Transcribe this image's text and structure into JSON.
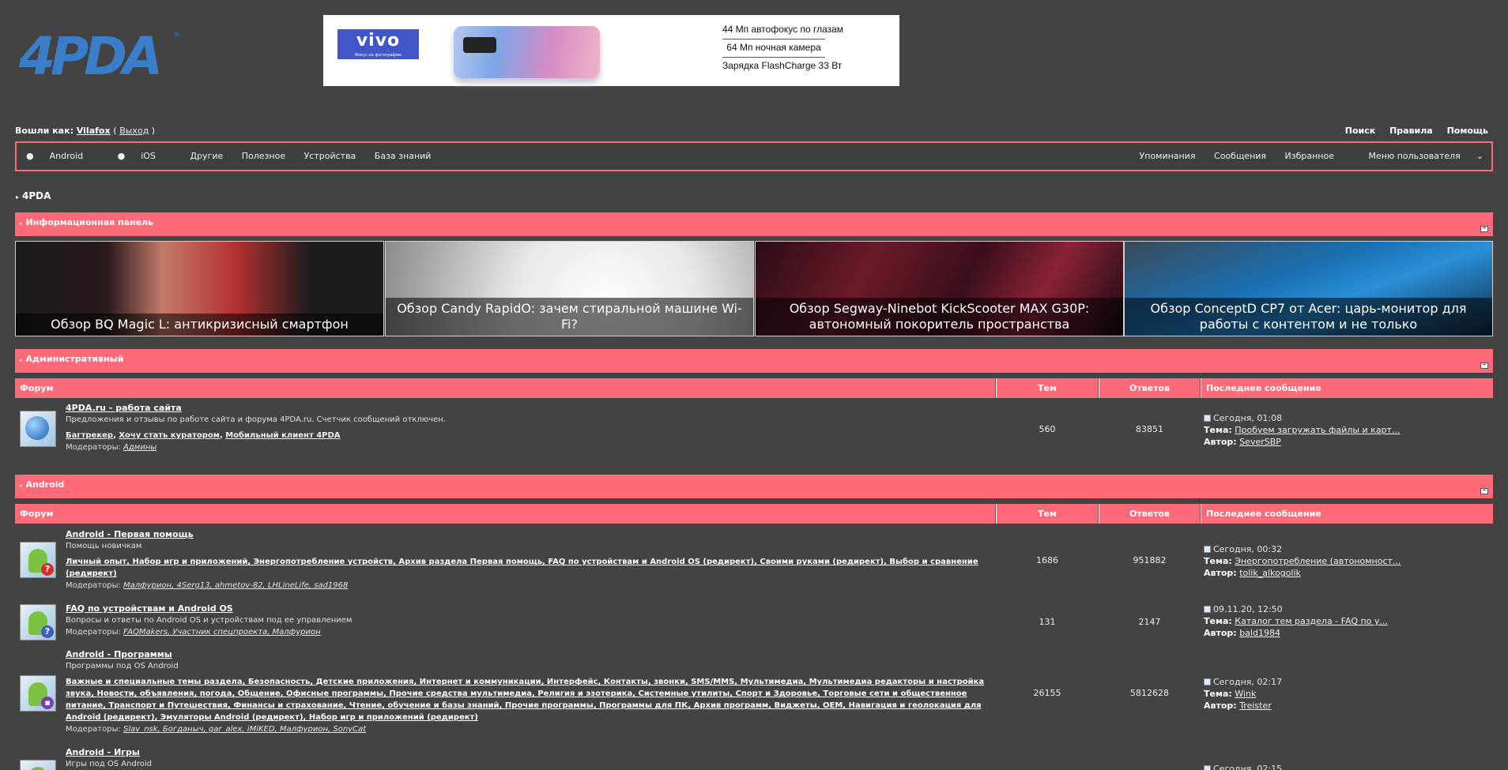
{
  "header": {
    "logo_text": "4PDA",
    "logo_mark": "®",
    "banner": {
      "brand": "vivo",
      "brand_tagline": "Фокус на фотографию",
      "features": [
        "44 Мп автофокус по глазам",
        "64 Мп ночная камера",
        "Зарядка FlashCharge 33 Вт"
      ]
    },
    "user": {
      "label": "Вошли как:",
      "name": "Vilafox",
      "logout": "Выход"
    },
    "top_links": [
      "Поиск",
      "Правила",
      "Помощь"
    ]
  },
  "nav": {
    "left": [
      "Android",
      "iOS",
      "Другие",
      "Полезное",
      "Устройства",
      "База знаний"
    ],
    "right": [
      "Упоминания",
      "Сообщения",
      "Избранное",
      "Меню пользователя"
    ]
  },
  "breadcrumb": "4PDA",
  "info_panel": {
    "title": "Информационная панель",
    "news": [
      "Обзор BQ Magic L: антикризисный смартфон",
      "Обзор Candy RapidO: зачем стиральной машине Wi-Fi?",
      "Обзор Segway-Ninebot KickScooter MAX G30P: автономный покоритель пространства",
      "Обзор ConceptD CP7 от Acer: царь-монитор для работы с контентом и не только"
    ]
  },
  "columns": {
    "forum": "Форум",
    "topics": "Тем",
    "replies": "Ответов",
    "last": "Последнее сообщение"
  },
  "last_labels": {
    "topic": "Тема:",
    "author": "Автор:"
  },
  "moderators_label": "Модераторы:",
  "admin": {
    "title": "Административный",
    "forums": [
      {
        "name": "4PDA.ru - работа сайта",
        "desc": "Предложения и отзывы по работе сайта и форума 4PDA.ru. Счетчик сообщений отключен.",
        "subforums": [
          "Багтрекер",
          "Хочу стать куратором",
          "Мобильный клиент 4PDA"
        ],
        "moderators": [
          "Админы"
        ],
        "topics": "560",
        "replies": "83851",
        "last_date": "Сегодня, 01:08",
        "last_topic": "Пробуем загружать файлы и карт...",
        "last_author": "SeverSBP"
      }
    ]
  },
  "android": {
    "title": "Android",
    "forums": [
      {
        "name": "Android - Первая помощь",
        "desc": "Помощь новичкам",
        "subforums_text": "Личный опыт, Набор игр и приложений, Энергопотребление устройств, Архив раздела Первая помощь, FAQ по устройствам и Android OS (редирект), Своими руками (редирект), Выбор и сравнение (редирект)",
        "moderators": "Малфурион, 4Serg13, ahmetov-82, LHLineLife, sad1968",
        "topics": "1686",
        "replies": "951882",
        "last_date": "Сегодня, 00:32",
        "last_topic": "Энергопотребление (автономност...",
        "last_author": "tolik_alkogolik"
      },
      {
        "name": "FAQ по устройствам и Android OS",
        "desc": "Вопросы и ответы по Android OS и устройствам под ее управлением",
        "moderators": "FAQMakers, Участник спецпроекта, Малфурион",
        "topics": "131",
        "replies": "2147",
        "last_date": "09.11.20, 12:50",
        "last_topic": "Каталог тем раздела - FAQ по у...",
        "last_author": "bald1984"
      },
      {
        "name": "Android - Программы",
        "desc": "Программы под OS Android",
        "subforums_text": "Важные и специальные темы раздела, Безопасность, Детские приложения, Интернет и коммуникации, Интерфейс, Контакты, звонки, SMS/MMS, Мультимедиа, Мультимедиа редакторы и настройка звука, Новости, объявления, погода, Общение, Офисные программы, Прочие средства мультимедиа, Религия и эзотерика, Системные утилиты, Спорт и Здоровье, Торговые сети и общественное питание, Транспорт и Путешествия, Финансы и страхование, Чтение, обучение и базы знаний, Прочие программы, Программы для ПК, Архив программ, Виджеты, OEM, Навигация и геолокация для Android (редирект), Эмуляторы Android (редирект), Набор игр и приложений (редирект)",
        "moderators": "Slav_nsk, Богданыч, gar_alex, iMiKED, Малфурион, SonyCat",
        "topics": "26155",
        "replies": "5812628",
        "last_date": "Сегодня, 02:17",
        "last_topic": "Wink",
        "last_author": "Treister"
      },
      {
        "name": "Android - Игры",
        "desc": "Игры под OS Android",
        "last_date": "Сегодня, 02:15"
      }
    ]
  }
}
